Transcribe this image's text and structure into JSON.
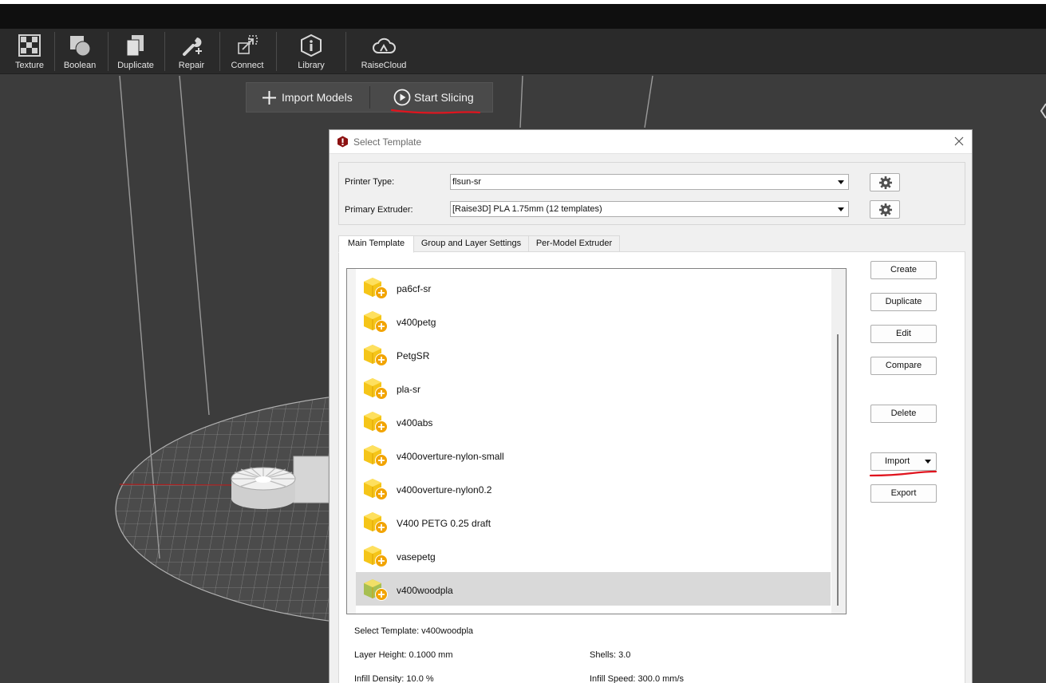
{
  "toolbar": {
    "items": [
      {
        "label": "Texture",
        "icon": "texture-icon"
      },
      {
        "label": "Boolean",
        "icon": "boolean-icon"
      },
      {
        "label": "Duplicate",
        "icon": "duplicate-icon"
      },
      {
        "label": "Repair",
        "icon": "repair-icon"
      },
      {
        "label": "Connect",
        "icon": "connect-icon"
      },
      {
        "label": "Library",
        "icon": "library-icon"
      },
      {
        "label": "RaiseCloud",
        "icon": "cloud-icon"
      }
    ]
  },
  "actions": {
    "import_models": "Import Models",
    "start_slicing": "Start Slicing"
  },
  "dialog": {
    "title": "Select Template",
    "printer_type_label": "Printer Type:",
    "printer_type_value": "flsun-sr",
    "primary_extruder_label": "Primary Extruder:",
    "primary_extruder_value": "[Raise3D] PLA 1.75mm (12 templates)",
    "tabs": [
      "Main Template",
      "Group and Layer Settings",
      "Per-Model Extruder"
    ],
    "active_tab": "Main Template",
    "templates": [
      {
        "name": "pa6cf-sr",
        "selected": false
      },
      {
        "name": "v400petg",
        "selected": false
      },
      {
        "name": "PetgSR",
        "selected": false
      },
      {
        "name": "pla-sr",
        "selected": false
      },
      {
        "name": "v400abs",
        "selected": false
      },
      {
        "name": "v400overture-nylon-small",
        "selected": false
      },
      {
        "name": "v400overture-nylon0.2",
        "selected": false
      },
      {
        "name": "V400 PETG 0.25 draft",
        "selected": false
      },
      {
        "name": "vasepetg",
        "selected": false
      },
      {
        "name": "v400woodpla",
        "selected": true
      }
    ],
    "buttons": {
      "create": "Create",
      "duplicate": "Duplicate",
      "edit": "Edit",
      "compare": "Compare",
      "delete": "Delete",
      "import": "Import",
      "export": "Export"
    },
    "info": {
      "select_template": "Select Template: v400woodpla",
      "layer_height": "Layer Height: 0.1000 mm",
      "shells": "Shells: 3.0",
      "infill_density": "Infill Density: 10.0 %",
      "infill_speed": "Infill Speed: 300.0 mm/s"
    }
  },
  "colors": {
    "annotation_red": "#e0141e",
    "template_icon_yellow": "#f5c518",
    "template_icon_selected_green": "#a7bf52"
  }
}
